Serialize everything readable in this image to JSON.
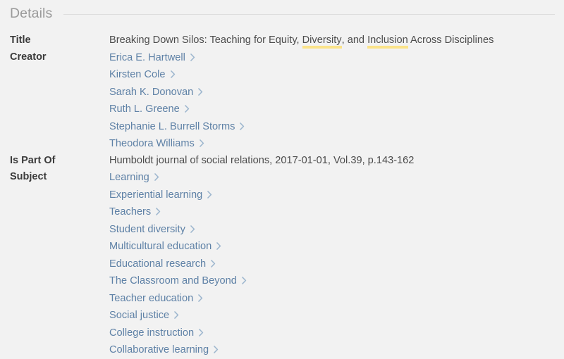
{
  "section": {
    "title": "Details"
  },
  "rows": [
    {
      "label": "Title",
      "type": "text",
      "segments": [
        {
          "text": "Breaking Down Silos: Teaching for Equity, ",
          "highlight": false
        },
        {
          "text": "Diversity",
          "highlight": true
        },
        {
          "text": ", and ",
          "highlight": false
        },
        {
          "text": "Inclusion",
          "highlight": true
        },
        {
          "text": " Across Disciplines",
          "highlight": false
        }
      ],
      "plain": "Breaking Down Silos: Teaching for Equity, Diversity, and Inclusion Across Disciplines"
    },
    {
      "label": "Creator",
      "type": "links",
      "links": [
        "Erica E. Hartwell",
        "Kirsten Cole",
        "Sarah K. Donovan",
        "Ruth L. Greene",
        "Stephanie L. Burrell Storms",
        "Theodora Williams"
      ]
    },
    {
      "label": "Is Part Of",
      "type": "text",
      "segments": [
        {
          "text": "Humboldt journal of social relations, 2017-01-01, Vol.39, p.143-162",
          "highlight": false
        }
      ],
      "plain": "Humboldt journal of social relations, 2017-01-01, Vol.39, p.143-162"
    },
    {
      "label": "Subject",
      "type": "links",
      "links": [
        "Learning",
        "Experiential learning",
        "Teachers",
        "Student diversity",
        "Multicultural education",
        "Educational research",
        "The Classroom and Beyond",
        "Teacher education",
        "Social justice",
        "College instruction",
        "Collaborative learning"
      ]
    }
  ],
  "icons": {
    "chevron": "chevron-right-icon"
  },
  "colors": {
    "background": "#f2f2f2",
    "label": "#3b3b3b",
    "value": "#4c4c4c",
    "link": "#5e81a6",
    "highlight": "#fbe38a",
    "heading": "#9a9a9a",
    "rule": "#dedede"
  }
}
